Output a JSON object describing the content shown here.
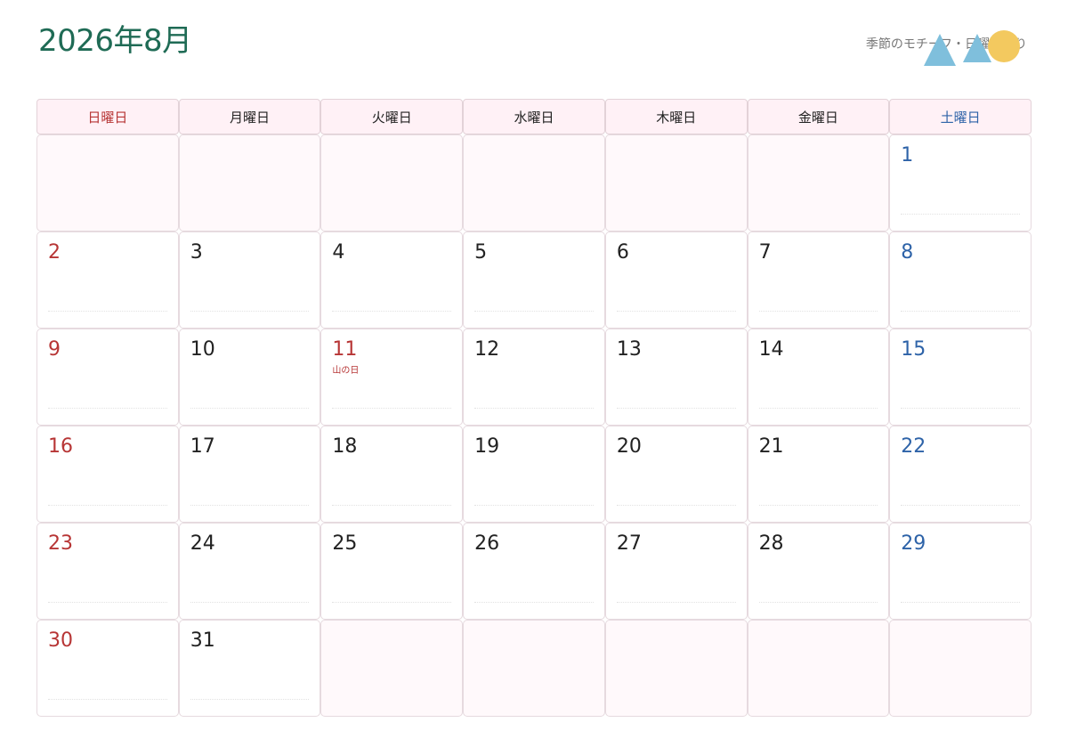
{
  "header": {
    "title": "2026年8月",
    "motif_label": "季節のモチーフ・日曜始まり"
  },
  "weekdays": [
    {
      "label": "日曜日",
      "type": "sun"
    },
    {
      "label": "月曜日",
      "type": "weekday"
    },
    {
      "label": "火曜日",
      "type": "weekday"
    },
    {
      "label": "水曜日",
      "type": "weekday"
    },
    {
      "label": "木曜日",
      "type": "weekday"
    },
    {
      "label": "金曜日",
      "type": "weekday"
    },
    {
      "label": "土曜日",
      "type": "sat"
    }
  ],
  "calendar": {
    "first_weekday_index": 6,
    "days_in_month": 31,
    "holidays": [
      {
        "day": 11,
        "label": "山の日"
      }
    ]
  },
  "colors": {
    "title": "#1f6b55",
    "sunday": "#b73535",
    "saturday": "#2e63a8",
    "header_bg": "#fff1f6",
    "empty_bg": "#fff9fb",
    "motif_triangle": "#7fbfdc",
    "motif_circle": "#f3c95f"
  },
  "motif_icons": [
    "triangle-icon",
    "triangle-icon",
    "circle-icon"
  ]
}
